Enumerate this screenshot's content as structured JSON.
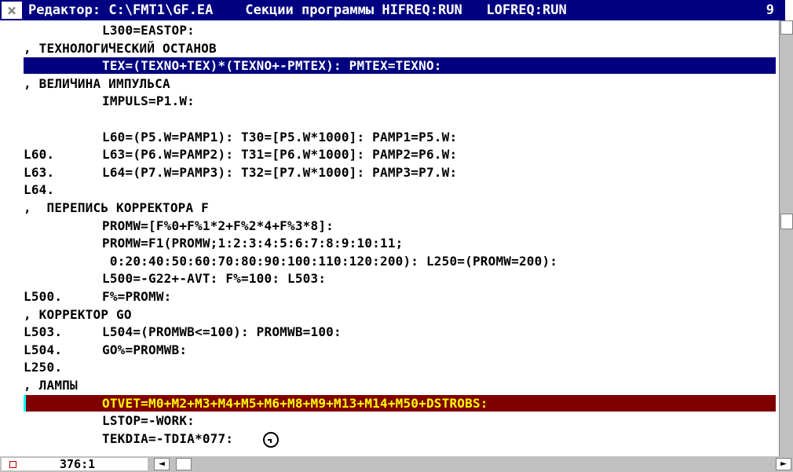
{
  "title_bar": {
    "close_glyph": "×",
    "text": "Редактор: C:\\FMT1\\GF.EA    Секции программы HIFREQ:RUN   LOFREQ:RUN",
    "number": "9"
  },
  "lines": [
    {
      "label": "",
      "comment": "",
      "code": "L300=EASTOP:"
    },
    {
      "label": "",
      "comment": ", ТЕХНОЛОГИЧЕСКИЙ ОСТАНОВ",
      "code": ""
    },
    {
      "label": "",
      "comment": "",
      "code": "TEX=(TEXNO+TEX)*(TEXNO+-PMTEX): PMTEX=TEXNO:",
      "highlight": "blue"
    },
    {
      "label": "",
      "comment": ", ВЕЛИЧИНА ИМПУЛЬСА",
      "code": ""
    },
    {
      "label": "",
      "comment": "",
      "code": "IMPULS=P1.W:"
    },
    {
      "label": "",
      "comment": "",
      "code": ""
    },
    {
      "label": "",
      "comment": "",
      "code": "L60=(P5.W=PAMP1): T30=[P5.W*1000]: PAMP1=P5.W:"
    },
    {
      "label": "L60.",
      "comment": "",
      "code": "L63=(P6.W=PAMP2): T31=[P6.W*1000]: PAMP2=P6.W:"
    },
    {
      "label": "L63.",
      "comment": "",
      "code": "L64=(P7.W=PAMP3): T32=[P7.W*1000]: PAMP3=P7.W:"
    },
    {
      "label": "L64.",
      "comment": "",
      "code": ""
    },
    {
      "label": "",
      "comment": ",  ПЕРЕПИСЬ КОРРЕКТОРА F",
      "code": ""
    },
    {
      "label": "",
      "comment": "",
      "code": "PROMW=[F%0+F%1*2+F%2*4+F%3*8]:"
    },
    {
      "label": "",
      "comment": "",
      "code": "PROMW=F1(PROMW;1:2:3:4:5:6:7:8:9:10:11;"
    },
    {
      "label": "",
      "comment": "",
      "code": " 0:20:40:50:60:70:80:90:100:110:120:200): L250=(PROMW=200):"
    },
    {
      "label": "",
      "comment": "",
      "code": "L500=-G22+-AVT: F%=100: L503:"
    },
    {
      "label": "L500.",
      "comment": "",
      "code": "F%=PROMW:"
    },
    {
      "label": "",
      "comment": ", КОРРЕКТОР GO",
      "code": ""
    },
    {
      "label": "L503.",
      "comment": "",
      "code": "L504=(PROMWB<=100): PROMWB=100:"
    },
    {
      "label": "L504.",
      "comment": "",
      "code": "GO%=PROMWB:"
    },
    {
      "label": "L250.",
      "comment": "",
      "code": ""
    },
    {
      "label": "",
      "comment": ", ЛАМПЫ",
      "code": ""
    },
    {
      "label": "",
      "comment": "",
      "code": "OTVET=M0+M2+M3+M4+M5+M6+M8+M9+M13+M14+M50+DSTROBS:",
      "highlight": "red"
    },
    {
      "label": "",
      "comment": "",
      "code": "LSTOP=-WORK:"
    },
    {
      "label": "",
      "comment": "",
      "code": "TEKDIA=-TDIA*077:"
    }
  ],
  "status_bar": {
    "position": "376:1",
    "left_arrow": "◄",
    "right_arrow": "►"
  },
  "colors": {
    "title_bg": "#000080",
    "blue_highlight": "#000080",
    "red_highlight": "#800000",
    "red_highlight_text": "#ffff00",
    "cursor_bar": "#00ffff"
  }
}
